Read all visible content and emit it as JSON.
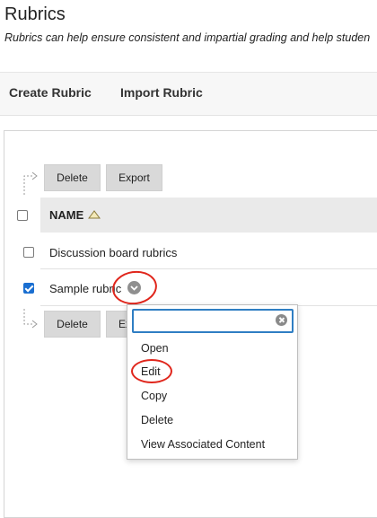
{
  "page": {
    "title": "Rubrics",
    "subtitle": "Rubrics can help ensure consistent and impartial grading and help studen"
  },
  "action_bar": {
    "create_label": "Create Rubric",
    "import_label": "Import Rubric"
  },
  "top_toolbar": {
    "delete_label": "Delete",
    "export_label": "Export"
  },
  "bottom_toolbar": {
    "delete_label": "Delete",
    "export_label_visible": "Ex"
  },
  "table": {
    "columns": [
      {
        "label": "NAME",
        "sort": "ascending"
      }
    ],
    "rows": [
      {
        "name": "Discussion board rubrics",
        "checked": false
      },
      {
        "name": "Sample rubric",
        "checked": true
      }
    ]
  },
  "context_menu": {
    "search_value": "",
    "items": [
      "Open",
      "Edit",
      "Copy",
      "Delete",
      "View Associated Content"
    ]
  },
  "colors": {
    "accent": "#1a6fd1",
    "annotation": "#e0261c",
    "focus_border": "#2f7ec3",
    "button_bg": "#d9d9d9"
  },
  "icons": [
    "sort-ascending-icon",
    "chevron-down-icon",
    "clear-search-icon",
    "toolbar-arrow-icon"
  ]
}
